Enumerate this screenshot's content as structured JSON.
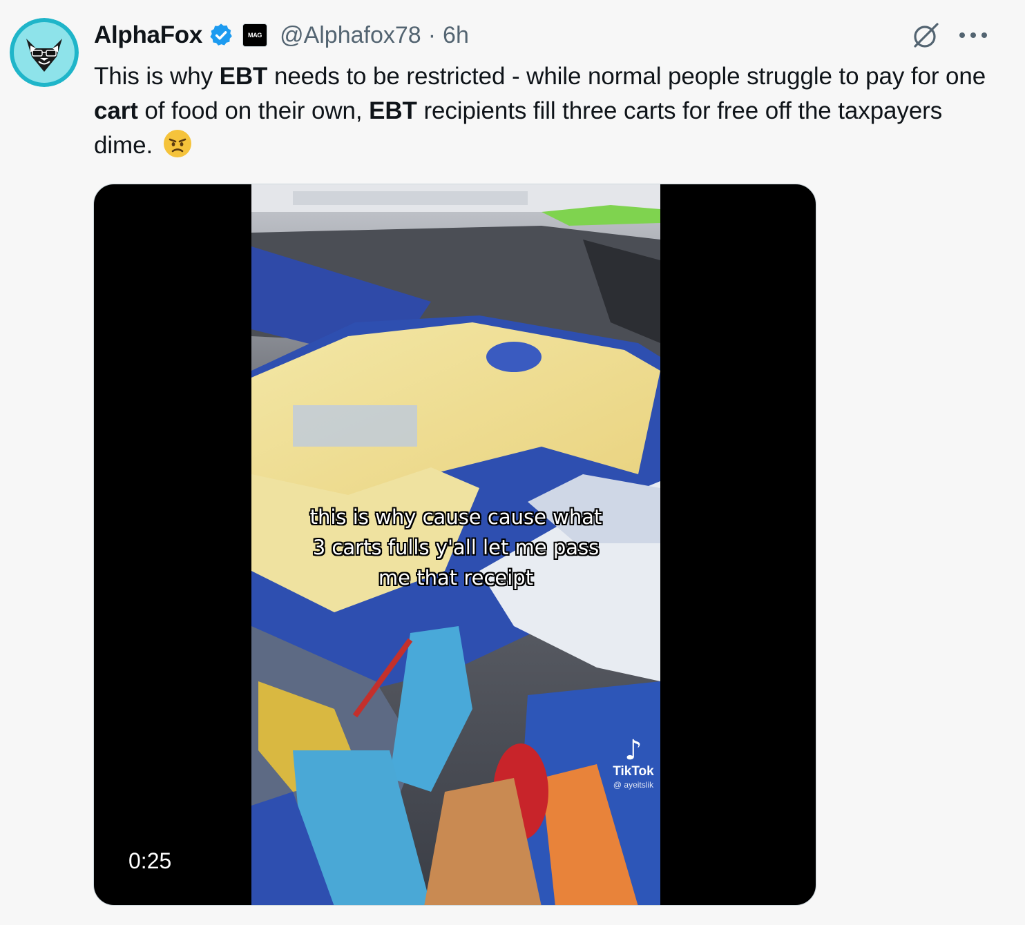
{
  "author": {
    "display_name": "AlphaFox",
    "handle": "@Alphafox78",
    "separator": "·",
    "time_ago": "6h",
    "affiliate_badge_text": "MAG",
    "verified": true,
    "verified_color": "#1d9bf0"
  },
  "tweet": {
    "text_parts": [
      "This is why ",
      "EBT",
      " needs to be restricted  - while normal people struggle to pay for one ",
      "cart",
      " of food on their own, ",
      "EBT",
      " recipients fill three carts for free off the taxpayers dime."
    ],
    "emoji": "angry-face"
  },
  "media": {
    "type": "video",
    "duration": "0:25",
    "caption_lines": [
      "this is why cause cause what",
      "3 carts fulls y'all let me pass",
      "me that receipt"
    ],
    "watermark_brand": "TikTok",
    "watermark_user": "@ ayeitslik"
  },
  "icons": {
    "grok": "grok-icon",
    "more": "more-horizontal-icon",
    "verified": "verified-badge-icon",
    "emoji": "angry-face-emoji-icon"
  }
}
